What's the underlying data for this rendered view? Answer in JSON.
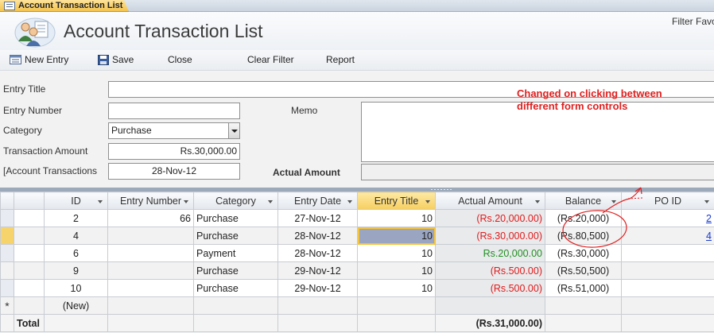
{
  "tab": {
    "title": "Account Transaction List"
  },
  "header": {
    "title": "Account Transaction List",
    "filter_favorites": "Filter Favo"
  },
  "toolbar": {
    "new_entry": "New Entry",
    "save": "Save",
    "close": "Close",
    "clear_filter": "Clear Filter",
    "report": "Report"
  },
  "form": {
    "entry_title_label": "Entry Title",
    "entry_title_value": "",
    "entry_number_label": "Entry Number",
    "entry_number_value": "",
    "category_label": "Category",
    "category_value": "Purchase",
    "transaction_amount_label": "Transaction Amount",
    "transaction_amount_value": "Rs.30,000.00",
    "account_transactions_label": "[Account Transactions",
    "account_transactions_value": "28-Nov-12",
    "memo_label": "Memo",
    "memo_value": "",
    "actual_amount_label": "Actual Amount",
    "actual_amount_value": ""
  },
  "annotation": {
    "line1": "Changed on clicking between",
    "line2": "different form controls"
  },
  "grid": {
    "columns": [
      "ID",
      "Entry Number",
      "Category",
      "Entry Date",
      "Entry Title",
      "Actual Amount",
      "Balance",
      "PO ID"
    ],
    "rows": [
      {
        "id": "2",
        "entry_number": "66",
        "category": "Purchase",
        "entry_date": "27-Nov-12",
        "entry_title": "10",
        "actual_amount": "(Rs.20,000.00)",
        "balance": "(Rs.20,000)",
        "po_id": "2"
      },
      {
        "id": "4",
        "entry_number": "",
        "category": "Purchase",
        "entry_date": "28-Nov-12",
        "entry_title": "10",
        "actual_amount": "(Rs.30,000.00)",
        "balance": "(Rs.80,500)",
        "po_id": "4"
      },
      {
        "id": "6",
        "entry_number": "",
        "category": "Payment",
        "entry_date": "28-Nov-12",
        "entry_title": "10",
        "actual_amount": "Rs.20,000.00",
        "balance": "(Rs.30,000)",
        "po_id": ""
      },
      {
        "id": "9",
        "entry_number": "",
        "category": "Purchase",
        "entry_date": "29-Nov-12",
        "entry_title": "10",
        "actual_amount": "(Rs.500.00)",
        "balance": "(Rs.50,500)",
        "po_id": ""
      },
      {
        "id": "10",
        "entry_number": "",
        "category": "Purchase",
        "entry_date": "29-Nov-12",
        "entry_title": "10",
        "actual_amount": "(Rs.500.00)",
        "balance": "(Rs.51,000)",
        "po_id": ""
      }
    ],
    "new_row_marker": "*",
    "new_row_label": "(New)",
    "total_label": "Total",
    "total_actual_amount": "(Rs.31,000.00)"
  },
  "colors": {
    "negative": "#e21b1b",
    "positive": "#229022",
    "annotation": "#e02020",
    "link": "#1a3ccf",
    "current_row": "#f7d36b"
  }
}
